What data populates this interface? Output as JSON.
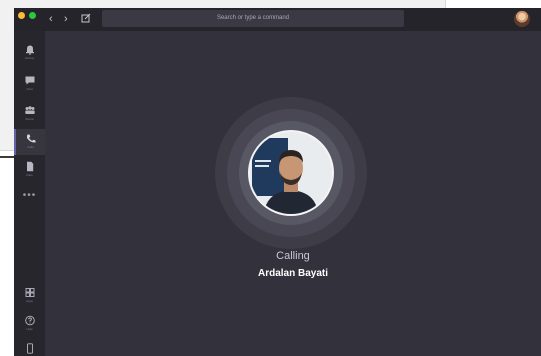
{
  "titlebar": {
    "search_placeholder": "Search or type a command"
  },
  "rail": {
    "items": [
      {
        "label": "Activity",
        "icon": "bell-icon"
      },
      {
        "label": "Chat",
        "icon": "chat-icon"
      },
      {
        "label": "Teams",
        "icon": "teams-icon"
      },
      {
        "label": "Calls",
        "icon": "phone-icon"
      },
      {
        "label": "Files",
        "icon": "file-icon"
      }
    ],
    "more": "•••",
    "bottom": [
      {
        "label": "Apps",
        "icon": "apps-icon"
      },
      {
        "label": "Help",
        "icon": "help-icon"
      }
    ]
  },
  "call": {
    "status": "Calling",
    "caller": "Ardalan Bayati"
  },
  "colors": {
    "accent": "#6264a7",
    "background": "#33323c",
    "rail": "#27262d"
  }
}
